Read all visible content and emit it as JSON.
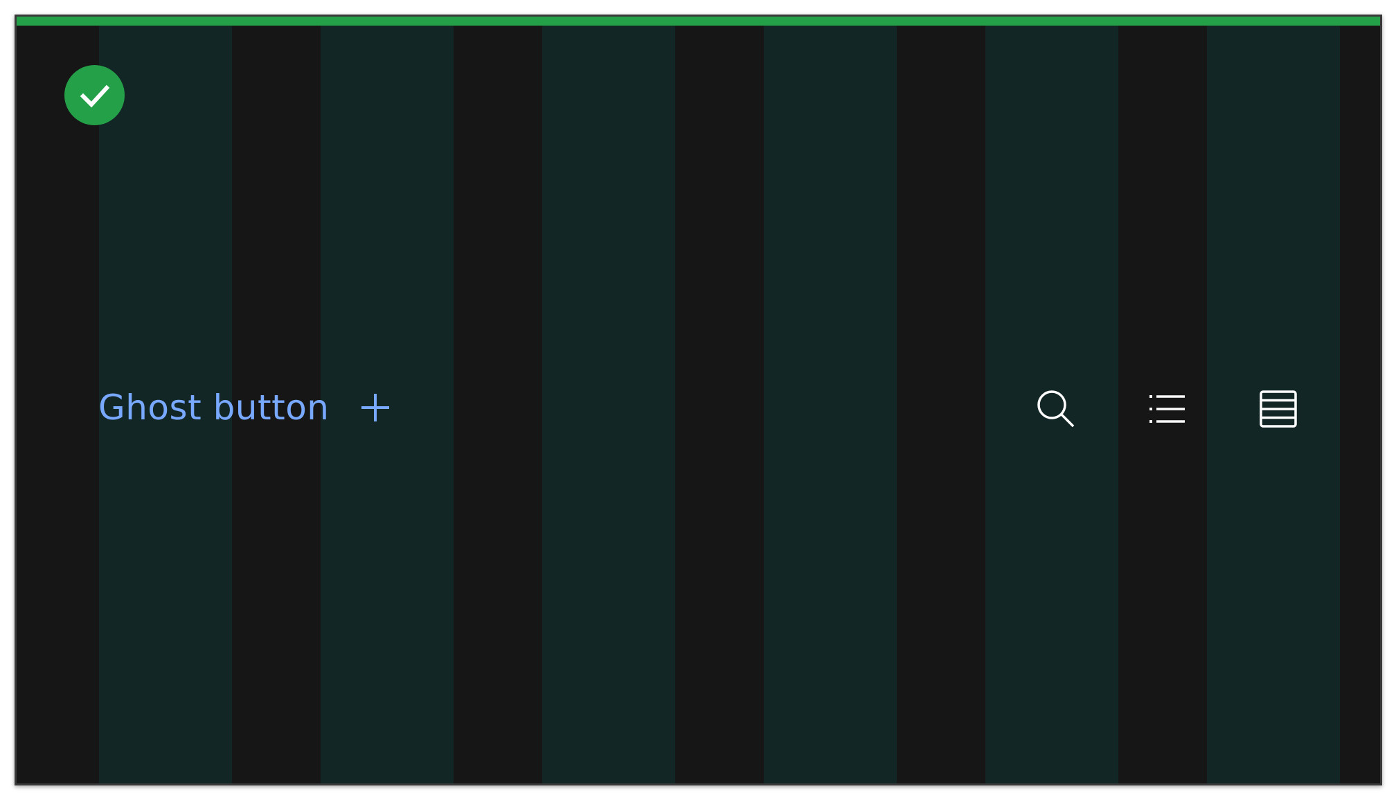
{
  "ghost_button": {
    "label": "Ghost button",
    "icon": "plus-icon"
  },
  "icon_buttons": [
    {
      "icon": "search-icon"
    },
    {
      "icon": "list-icon"
    },
    {
      "icon": "table-icon"
    }
  ],
  "status_badge": {
    "icon": "checkmark-icon"
  },
  "colors": {
    "background": "#161616",
    "column_overlay": "#132626",
    "accent_green": "#24a148",
    "ghost_text": "#78a9ff",
    "icon": "#ffffff",
    "border": "#393939"
  }
}
